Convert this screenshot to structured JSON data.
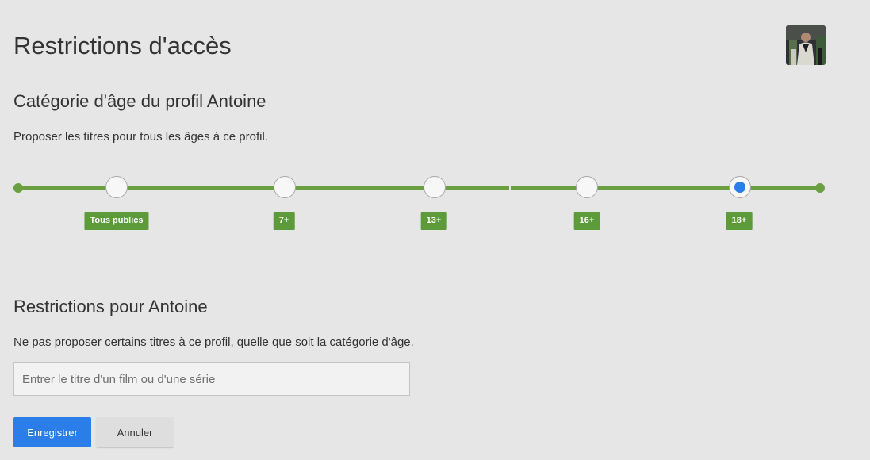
{
  "page": {
    "title": "Restrictions d'accès"
  },
  "profile": {
    "name": "Antoine",
    "avatar": "profile-photo"
  },
  "maturity": {
    "title": "Catégorie d'âge du profil Antoine",
    "description": "Proposer les titres pour tous les âges à ce profil.",
    "levels": [
      "Tous publics",
      "7+",
      "13+",
      "16+",
      "18+"
    ],
    "selected": "18+"
  },
  "restrictions": {
    "title": "Restrictions pour Antoine",
    "description": "Ne pas proposer certains titres à ce profil, quelle que soit la catégorie d'âge.",
    "search_placeholder": "Entrer le titre d'un film ou d'une série",
    "search_value": ""
  },
  "buttons": {
    "save": "Enregistrer",
    "cancel": "Annuler"
  },
  "colors": {
    "accent_green": "#6aa040",
    "badge_green": "#5c9a3a",
    "primary_blue": "#2b7de9",
    "background": "#e6e6e6"
  }
}
